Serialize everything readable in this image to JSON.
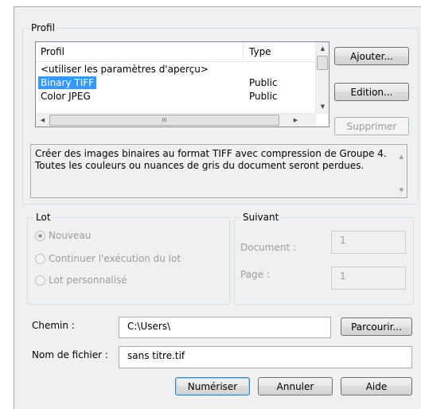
{
  "profile_group": {
    "title": "Profil",
    "columns": [
      "Profil",
      "Type"
    ],
    "rows": [
      {
        "name": "<utiliser les paramètres d'aperçu>",
        "type": "",
        "selected": false
      },
      {
        "name": "Binary TIFF",
        "type": "Public",
        "selected": true
      },
      {
        "name": "Color JPEG",
        "type": "Public",
        "selected": false
      }
    ],
    "buttons": {
      "add": "Ajouter...",
      "edit": "Edition...",
      "delete": "Supprimer"
    },
    "hscroll_thumb": "III",
    "description": "Créer des images binaires au format TIFF avec compression de Groupe 4. Toutes les couleurs ou nuances de gris du document seront perdues."
  },
  "lot_group": {
    "title": "Lot",
    "options": [
      "Nouveau",
      "Continuer l'exécution du lot",
      "Lot personnalisé"
    ],
    "selected_option": "Nouveau"
  },
  "next_group": {
    "title": "Suivant",
    "document_label": "Document :",
    "document_value": "1",
    "page_label": "Page :",
    "page_value": "1"
  },
  "path": {
    "label": "Chemin :",
    "value": "C:\\Users\\",
    "browse_label": "Parcourir..."
  },
  "filename": {
    "label": "Nom de fichier :",
    "value": "sans titre.tif"
  },
  "actions": {
    "scan": "Numériser",
    "cancel": "Annuler",
    "help": "Aide"
  }
}
